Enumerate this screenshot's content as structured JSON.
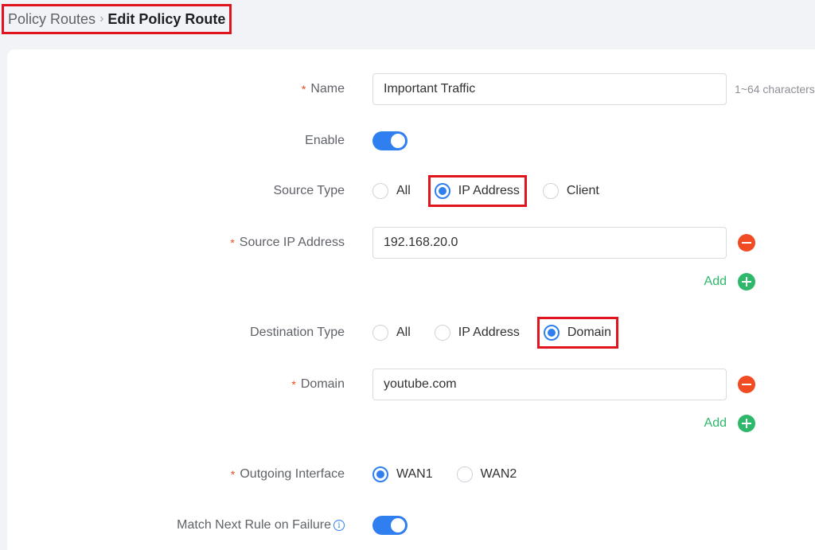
{
  "breadcrumb": {
    "parent": "Policy Routes",
    "separator": "›",
    "current": "Edit Policy Route"
  },
  "form": {
    "name": {
      "label": "Name",
      "required": "*",
      "value": "Important Traffic",
      "hint": "1~64 characters"
    },
    "enable": {
      "label": "Enable",
      "state": "on"
    },
    "source_type": {
      "label": "Source Type",
      "options": [
        "All",
        "IP Address",
        "Client"
      ],
      "selected": "IP Address"
    },
    "source_ip": {
      "label": "Source IP Address",
      "required": "*",
      "value": "192.168.20.0",
      "add_label": "Add"
    },
    "destination_type": {
      "label": "Destination Type",
      "options": [
        "All",
        "IP Address",
        "Domain"
      ],
      "selected": "Domain"
    },
    "domain": {
      "label": "Domain",
      "required": "*",
      "value": "youtube.com",
      "add_label": "Add"
    },
    "outgoing_interface": {
      "label": "Outgoing Interface",
      "required": "*",
      "options": [
        "WAN1",
        "WAN2"
      ],
      "selected": "WAN1"
    },
    "match_next_rule": {
      "label": "Match Next Rule on Failure",
      "info_glyph": "i",
      "state": "on"
    }
  },
  "colors": {
    "accent": "#2f7ff0",
    "required": "#f04b22",
    "add": "#2db86a",
    "highlight_box": "#e0141e"
  },
  "icons": {
    "remove": "minus-circle-icon",
    "add": "plus-circle-icon",
    "info": "info-circle-icon"
  }
}
